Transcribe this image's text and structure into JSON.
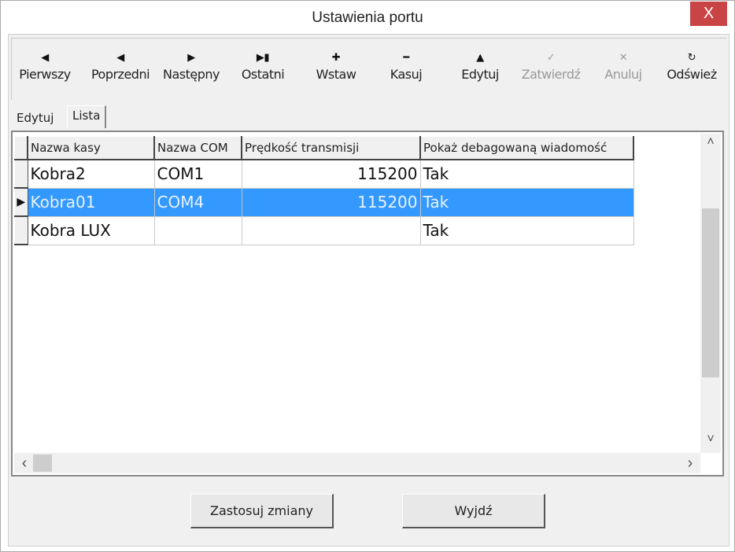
{
  "window": {
    "title": "Ustawienia portu",
    "close_label": "X"
  },
  "toolbar": [
    {
      "id": "first",
      "label": "Pierwszy",
      "icon": "first-icon",
      "glyph": "⏮",
      "enabled": true
    },
    {
      "id": "prev",
      "label": "Poprzedni",
      "icon": "prev-icon",
      "glyph": "◀",
      "enabled": true
    },
    {
      "id": "next",
      "label": "Następny",
      "icon": "next-icon",
      "glyph": "▶",
      "enabled": true
    },
    {
      "id": "last",
      "label": "Ostatni",
      "icon": "last-icon",
      "glyph": "⏭",
      "enabled": true
    },
    {
      "id": "insert",
      "label": "Wstaw",
      "icon": "plus-icon",
      "glyph": "✚",
      "enabled": true
    },
    {
      "id": "delete",
      "label": "Kasuj",
      "icon": "minus-icon",
      "glyph": "━",
      "enabled": true
    },
    {
      "id": "edit",
      "label": "Edytuj",
      "icon": "up-triangle-icon",
      "glyph": "▲",
      "enabled": true
    },
    {
      "id": "post",
      "label": "Zatwierdź",
      "icon": "check-icon",
      "glyph": "✓",
      "enabled": false
    },
    {
      "id": "cancel",
      "label": "Anuluj",
      "icon": "cancel-icon",
      "glyph": "✕",
      "enabled": false
    },
    {
      "id": "refresh",
      "label": "Odśwież",
      "icon": "refresh-icon",
      "glyph": "↻",
      "enabled": true
    }
  ],
  "tabs": [
    {
      "label": "Edytuj",
      "active": false
    },
    {
      "label": "Lista",
      "active": true
    }
  ],
  "grid": {
    "columns": [
      "Nazwa kasy",
      "Nazwa COM",
      "Prędkość transmisji",
      "Pokaż debagowaną wiadomość"
    ],
    "rows": [
      {
        "name": "Kobra2",
        "com": "COM1",
        "speed": "115200",
        "debug": "Tak",
        "selected": false
      },
      {
        "name": "Kobra01",
        "com": "COM4",
        "speed": "115200",
        "debug": "Tak",
        "selected": true
      },
      {
        "name": "Kobra LUX",
        "com": "",
        "speed": "",
        "debug": "Tak",
        "selected": false
      }
    ],
    "row_indicator": "▶",
    "colors": {
      "selection": "#3399ff"
    }
  },
  "scroll": {
    "up": "˄",
    "down": "˅",
    "left": "‹",
    "right": "›"
  },
  "buttons": {
    "apply": "Zastosuj zmiany",
    "exit": "Wyjdź"
  }
}
